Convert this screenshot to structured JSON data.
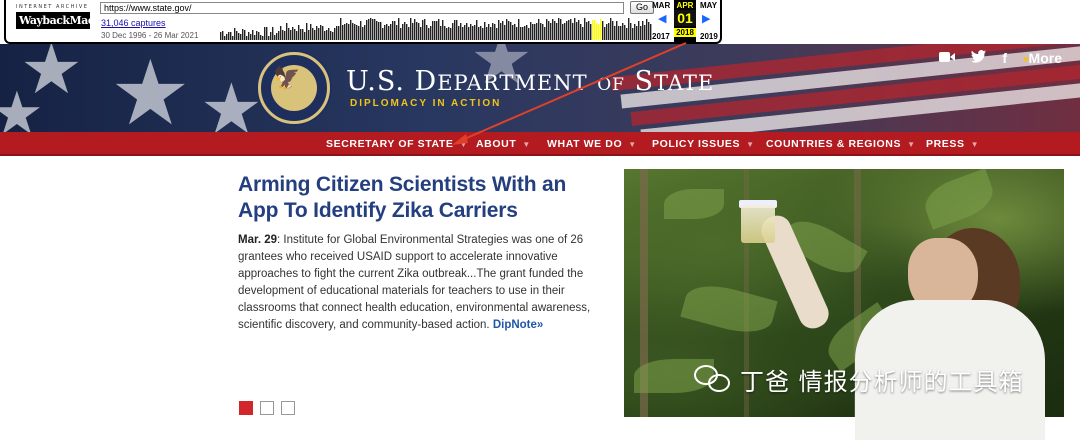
{
  "wayback": {
    "logo_top": "INTERNET ARCHIVE",
    "logo_main": "WaybackMachine",
    "url": "https://www.state.gov/",
    "go_label": "Go",
    "captures": "31,046 captures",
    "range": "30 Dec 1996 - 26 Mar 2021",
    "prev_month": "MAR",
    "cur_month": "APR",
    "next_month": "MAY",
    "cur_day": "01",
    "prev_year": "2017",
    "cur_year": "2018",
    "next_year": "2019"
  },
  "header": {
    "title_a": "U.S. D",
    "title_b": "EPARTMENT",
    "title_of": "OF",
    "title_c": "S",
    "title_d": "TATE",
    "tagline": "DIPLOMACY IN ACTION",
    "more_label": "More"
  },
  "nav": {
    "items": [
      "SECRETARY OF STATE",
      "ABOUT",
      "WHAT WE DO",
      "POLICY ISSUES",
      "COUNTRIES & REGIONS",
      "PRESS"
    ]
  },
  "article": {
    "headline": "Arming Citizen Scientists With an App To Identify Zika Carriers",
    "date": "Mar. 29",
    "body": ": Institute for Global Environmental Strategies was one of 26 grantees who received USAID support to accelerate innovative approaches to fight the current Zika outbreak...The grant funded the development of educational materials for teachers to use in their classrooms that connect health education, environmental awareness, scientific discovery, and community-based action. ",
    "link": "DipNote»"
  },
  "watermark": {
    "text": "丁爸 情报分析师的工具箱"
  },
  "colors": {
    "nav_red": "#b31b20",
    "headline_blue": "#243f80",
    "tag_gold": "#f0c419",
    "annotation_red": "#e0402a"
  },
  "icons": {
    "social": [
      "video-icon",
      "twitter-icon",
      "facebook-icon"
    ]
  }
}
